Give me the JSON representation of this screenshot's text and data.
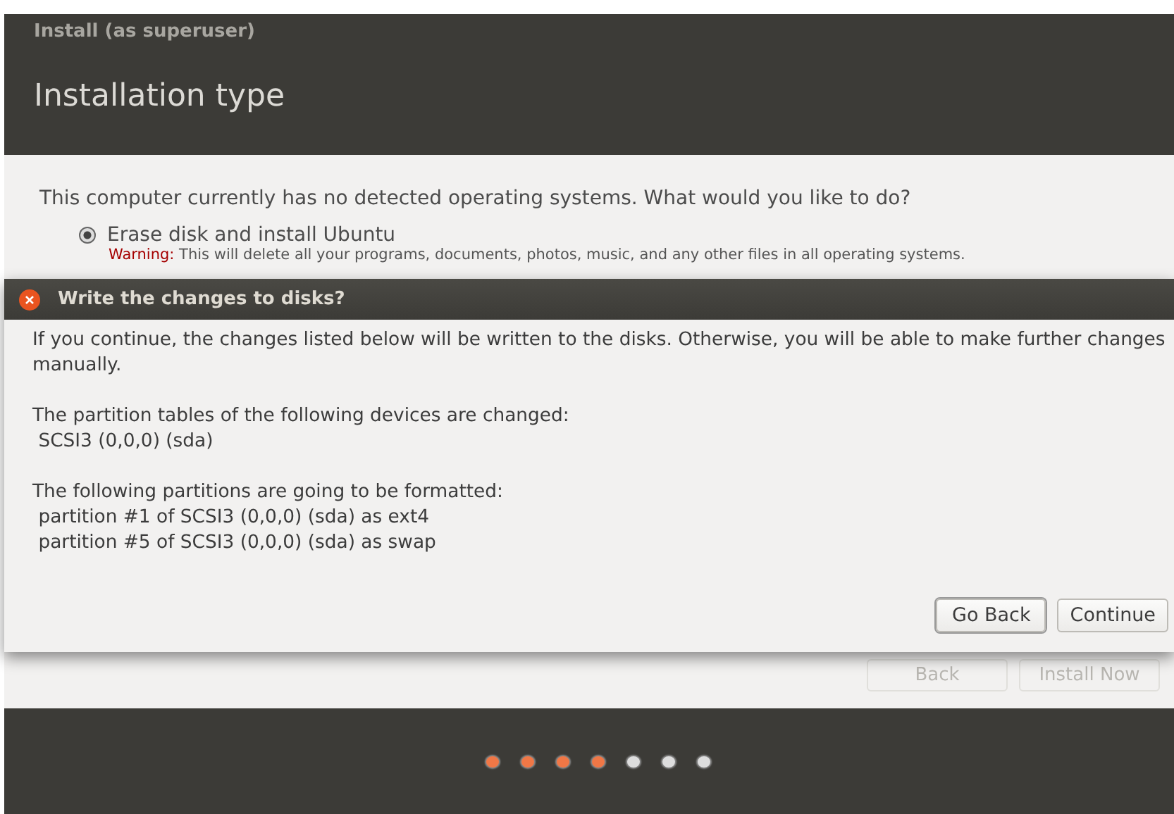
{
  "window": {
    "title": "Install (as superuser)",
    "heading": "Installation type"
  },
  "question": "This computer currently has no detected operating systems. What would you like to do?",
  "options": [
    {
      "label": "Erase disk and install Ubuntu",
      "selected": true,
      "warning_label": "Warning:",
      "warning": "This will delete all your programs, documents, photos, music, and any other files in all operating systems."
    }
  ],
  "buttons": [
    {
      "label": "Back",
      "disabled": true
    },
    {
      "label": "Install Now",
      "disabled": true
    }
  ],
  "progress": [
    {
      "done": true
    },
    {
      "done": true
    },
    {
      "done": true
    },
    {
      "done": true
    },
    {
      "done": false
    },
    {
      "done": false
    },
    {
      "done": false
    }
  ],
  "dialog": {
    "title": "Write the changes to disks?",
    "paragraphs": [
      [
        "If you continue, the changes listed below will be written to the disks. Otherwise, you will be able to make further changes manually."
      ],
      [
        "The partition tables of the following devices are changed:",
        " SCSI3 (0,0,0) (sda)"
      ],
      [
        "The following partitions are going to be formatted:",
        " partition #1 of SCSI3 (0,0,0) (sda) as ext4",
        " partition #5 of SCSI3 (0,0,0) (sda) as swap"
      ]
    ],
    "buttons": [
      {
        "label": "Go Back",
        "focused": true
      },
      {
        "label": "Continue",
        "focused": false
      }
    ]
  }
}
